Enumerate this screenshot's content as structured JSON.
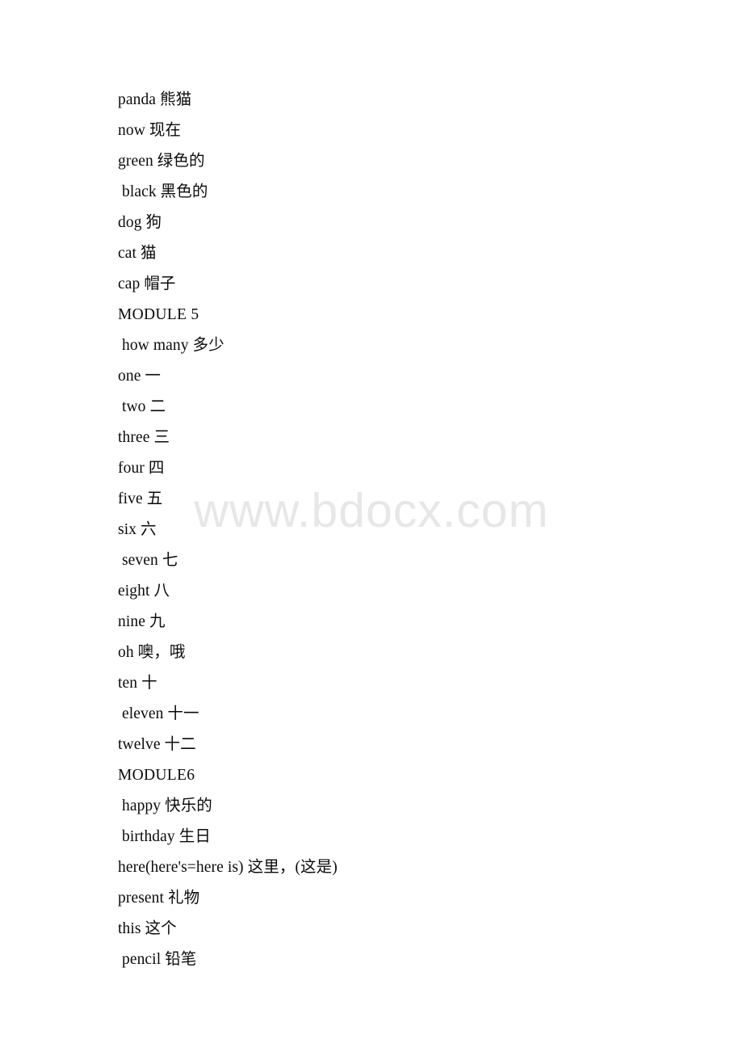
{
  "document": {
    "page_background": "#ffffff",
    "text_color": "#0b0b0b",
    "watermark": {
      "text": "www.bdocx.com",
      "color": "#e7e7e7"
    }
  },
  "lines": [
    {
      "text": "panda 熊猫",
      "kind": "entry"
    },
    {
      "text": "now 现在",
      "kind": "entry"
    },
    {
      "text": "green 绿色的",
      "kind": "entry"
    },
    {
      "text": " black 黑色的",
      "kind": "entry"
    },
    {
      "text": "dog 狗",
      "kind": "entry"
    },
    {
      "text": "cat 猫",
      "kind": "entry"
    },
    {
      "text": "cap 帽子",
      "kind": "entry"
    },
    {
      "text": "MODULE 5",
      "kind": "module"
    },
    {
      "text": " how many 多少",
      "kind": "entry"
    },
    {
      "text": "one 一",
      "kind": "entry"
    },
    {
      "text": " two 二",
      "kind": "entry"
    },
    {
      "text": "three 三",
      "kind": "entry"
    },
    {
      "text": "four 四",
      "kind": "entry"
    },
    {
      "text": "five 五",
      "kind": "entry"
    },
    {
      "text": "six 六",
      "kind": "entry"
    },
    {
      "text": " seven 七",
      "kind": "entry"
    },
    {
      "text": "eight 八",
      "kind": "entry"
    },
    {
      "text": "nine 九",
      "kind": "entry"
    },
    {
      "text": "oh 噢，哦",
      "kind": "entry"
    },
    {
      "text": "ten 十",
      "kind": "entry"
    },
    {
      "text": " eleven 十一",
      "kind": "entry"
    },
    {
      "text": "twelve 十二",
      "kind": "entry"
    },
    {
      "text": "MODULE6",
      "kind": "module"
    },
    {
      "text": " happy 快乐的",
      "kind": "entry"
    },
    {
      "text": " birthday 生日",
      "kind": "entry"
    },
    {
      "text": "here(here's=here is) 这里，(这是)",
      "kind": "entry"
    },
    {
      "text": "present 礼物",
      "kind": "entry"
    },
    {
      "text": "this 这个",
      "kind": "entry"
    },
    {
      "text": " pencil 铅笔",
      "kind": "entry"
    }
  ]
}
